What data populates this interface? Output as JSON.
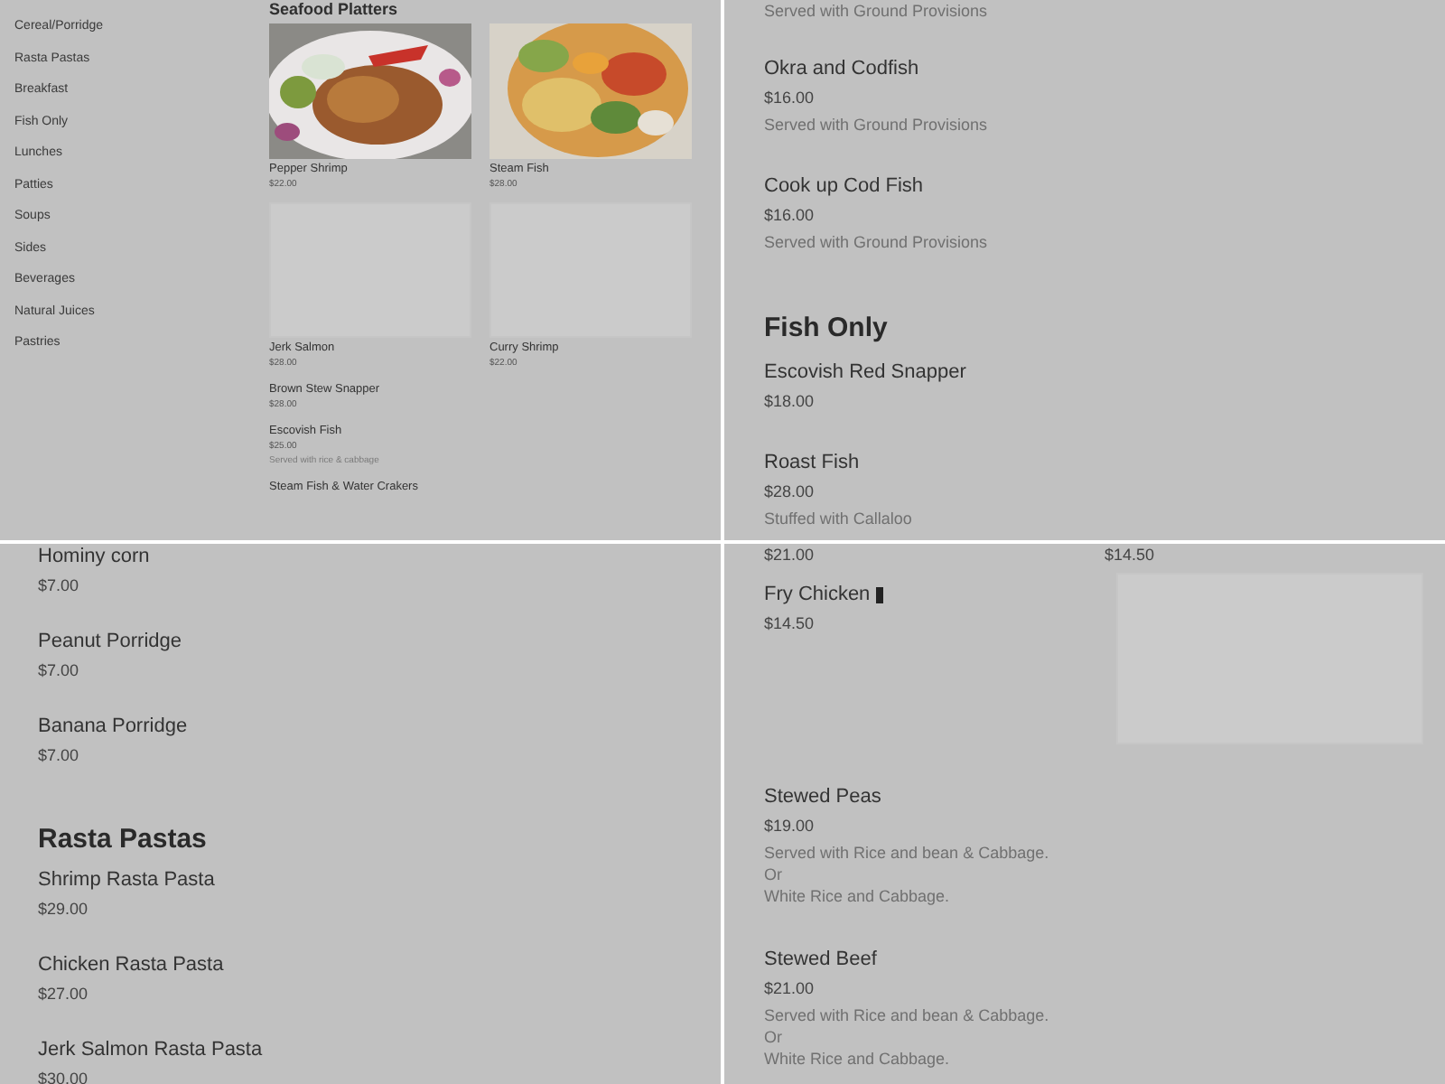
{
  "panels": [
    {
      "kind": "platters",
      "sidebar": {
        "items": [
          "Cereal/Porridge",
          "Rasta Pastas",
          "Breakfast",
          "Fish Only",
          "Lunches",
          "Patties",
          "Soups",
          "Sides",
          "Beverages",
          "Natural Juices",
          "Pastries"
        ]
      },
      "heading": "Seafood Platters",
      "cards": [
        {
          "name": "Pepper Shrimp",
          "price": "$22.00"
        },
        {
          "name": "Steam Fish",
          "price": "$28.00"
        },
        {
          "name": "Jerk Salmon",
          "price": "$28.00",
          "kind": "placeholder"
        },
        {
          "name": "Curry Shrimp",
          "price": "$22.00",
          "kind": "placeholder"
        }
      ],
      "items": [
        {
          "name": "Brown Stew Snapper",
          "price": "$28.00"
        },
        {
          "name": "Escovish Fish",
          "price": "$25.00",
          "description": [
            "Served with rice & cabbage"
          ]
        },
        {
          "name": "Steam Fish & Water Crakers"
        }
      ]
    },
    {
      "kind": "list",
      "blocks": [
        {
          "kind": "note",
          "text": "Served with Ground Provisions"
        },
        {
          "kind": "item",
          "name": "Okra and Codfish",
          "price": "$16.00",
          "description": [
            "Served with Ground Provisions"
          ]
        },
        {
          "kind": "item",
          "name": "Cook up Cod Fish",
          "price": "$16.00",
          "description": [
            "Served with Ground Provisions"
          ]
        },
        {
          "kind": "heading",
          "text": "Fish Only"
        },
        {
          "kind": "item",
          "name": "Escovish Red Snapper",
          "price": "$18.00"
        },
        {
          "kind": "item",
          "name": "Roast Fish",
          "price": "$28.00",
          "description": [
            "Stuffed with Callaloo"
          ]
        }
      ]
    },
    {
      "kind": "list",
      "blocks": [
        {
          "kind": "item",
          "name": "Hominy corn",
          "price": "$7.00"
        },
        {
          "kind": "item",
          "name": "Peanut Porridge",
          "price": "$7.00"
        },
        {
          "kind": "item",
          "name": "Banana Porridge",
          "price": "$7.00"
        },
        {
          "kind": "heading",
          "text": "Rasta Pastas"
        },
        {
          "kind": "item",
          "name": "Shrimp Rasta Pasta",
          "price": "$29.00"
        },
        {
          "kind": "item",
          "name": "Chicken Rasta Pasta",
          "price": "$27.00"
        },
        {
          "kind": "item",
          "name": "Jerk Salmon Rasta Pasta",
          "price": "$30.00"
        }
      ]
    },
    {
      "kind": "list",
      "blocks": [
        {
          "kind": "prices",
          "prices": [
            "$21.00",
            "$14.50"
          ]
        },
        {
          "kind": "item_with_placeholder",
          "name": "Fry Chicken",
          "price": "$14.50",
          "marker": true
        },
        {
          "kind": "item",
          "name": "Stewed Peas",
          "price": "$19.00",
          "description": [
            "Served with Rice and bean & Cabbage.",
            "Or",
            "White Rice and Cabbage."
          ]
        },
        {
          "kind": "item",
          "name": "Stewed Beef",
          "price": "$21.00",
          "description": [
            "Served with Rice and bean & Cabbage.",
            "Or",
            "White Rice and Cabbage."
          ]
        }
      ]
    }
  ]
}
